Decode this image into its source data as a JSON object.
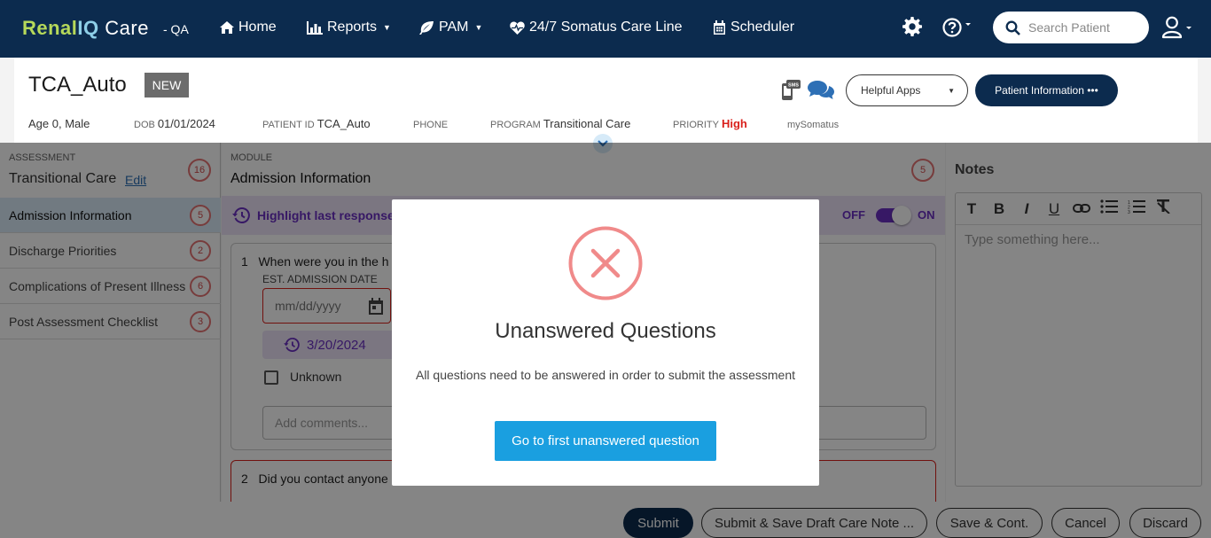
{
  "brand": {
    "part1": "Renal",
    "part2": "IQ",
    "part3": " Care",
    "env": "- QA"
  },
  "nav": {
    "home": "Home",
    "reports": "Reports",
    "pam": "PAM",
    "careline": "24/7 Somatus Care Line",
    "scheduler": "Scheduler"
  },
  "search": {
    "placeholder": "Search Patient"
  },
  "patient": {
    "name": "TCA_Auto",
    "badge": "NEW",
    "age_sex": "Age 0, Male",
    "dob_label": "DOB",
    "dob": "01/01/2024",
    "id_label": "PATIENT ID",
    "id": "TCA_Auto",
    "phone_label": "PHONE",
    "program_label": "PROGRAM",
    "program": "Transitional Care",
    "priority_label": "PRIORITY",
    "priority": "High",
    "mysomatus": "mySomatus"
  },
  "header_buttons": {
    "helpful_apps": "Helpful Apps",
    "patient_info": "Patient Information •••"
  },
  "assessment": {
    "label": "ASSESSMENT",
    "title": "Transitional Care",
    "edit": "Edit",
    "count": "16",
    "sections": [
      {
        "label": "Admission Information",
        "count": "5"
      },
      {
        "label": "Discharge Priorities",
        "count": "2"
      },
      {
        "label": "Complications of Present Illness",
        "count": "6"
      },
      {
        "label": "Post Assessment Checklist",
        "count": "3"
      }
    ]
  },
  "module": {
    "label": "MODULE",
    "title": "Admission Information",
    "count": "5",
    "highlight": "Highlight last responses",
    "toggle_off": "OFF",
    "toggle_on": "ON",
    "q1": {
      "number": "1",
      "text": "When were you in the h",
      "est_label": "EST. ADMISSION DATE",
      "date_placeholder": "mm/dd/yyyy",
      "last_response": "3/20/2024",
      "unknown": "Unknown",
      "comments_placeholder": "Add comments..."
    },
    "q2": {
      "number": "2",
      "text": "Did you contact anyone"
    }
  },
  "notes": {
    "title": "Notes",
    "placeholder": "Type something here..."
  },
  "actions": {
    "submit": "Submit",
    "submit_save": "Submit & Save Draft Care Note ...",
    "save_cont": "Save & Cont.",
    "cancel": "Cancel",
    "discard": "Discard"
  },
  "modal": {
    "title": "Unanswered Questions",
    "message": "All questions need to be answered in order to submit the assessment",
    "button": "Go to first unanswered question"
  },
  "colors": {
    "nav_bg": "#0c2b4e",
    "accent_purple": "#6a2fc2",
    "error_red": "#d9211c",
    "modal_button": "#1a9fe0"
  }
}
